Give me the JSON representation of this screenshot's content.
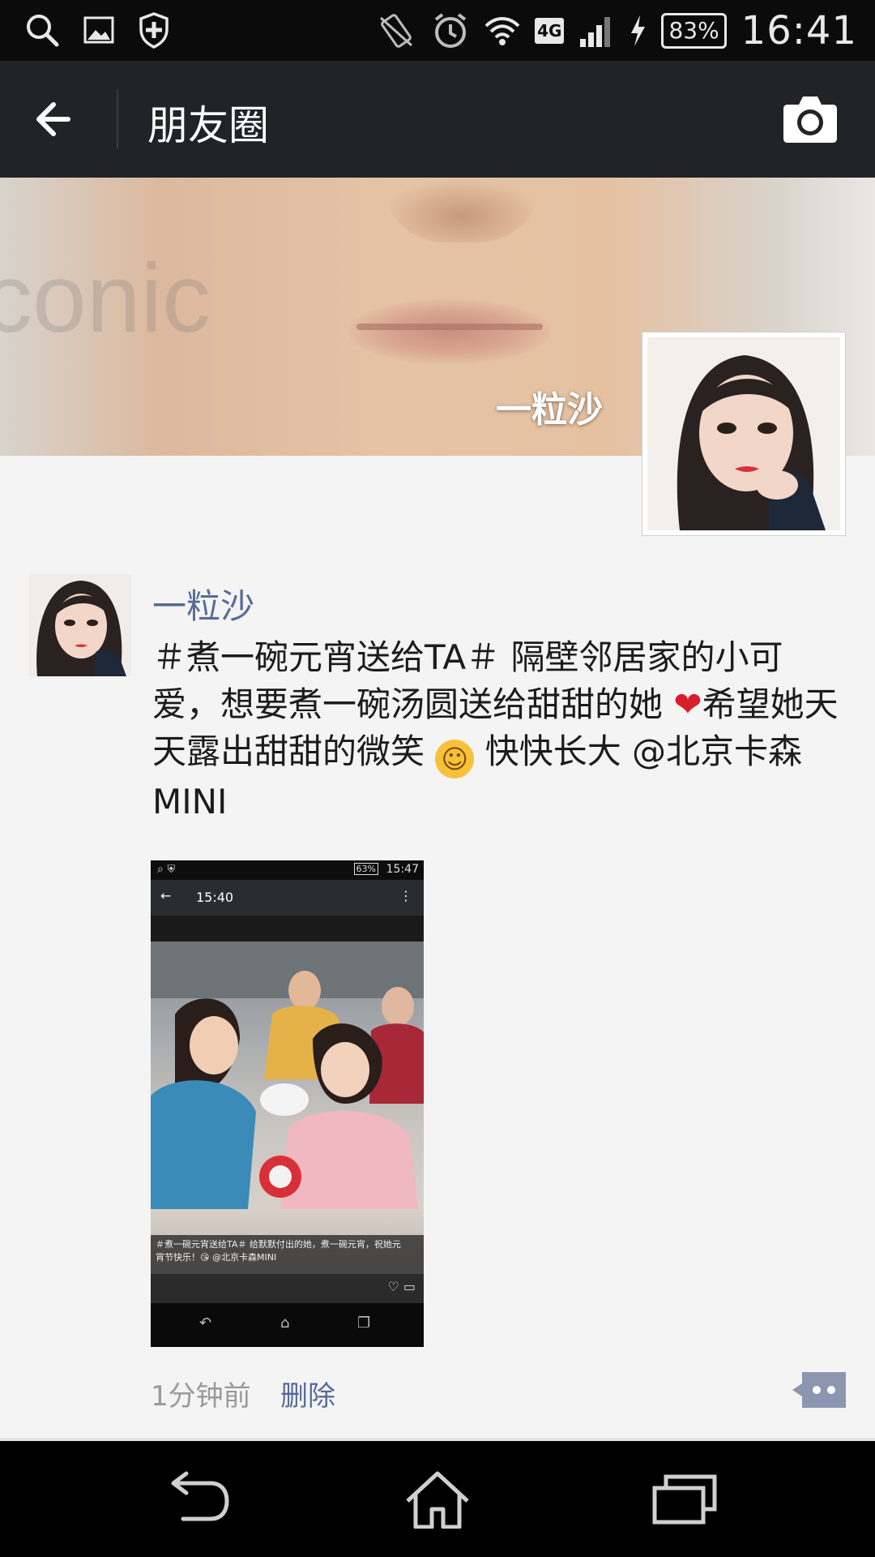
{
  "status_bar": {
    "time": "16:41",
    "battery": "83%",
    "network": "4G",
    "icons": [
      "search-icon",
      "gallery-icon",
      "shield-icon",
      "vibrate-icon",
      "alarm-icon",
      "wifi-icon",
      "signal-icon",
      "charging-icon"
    ]
  },
  "app_bar": {
    "title": "朋友圈",
    "back_icon": "back-arrow-icon",
    "camera_icon": "camera-icon"
  },
  "cover": {
    "watermark": "conic",
    "user_name": "一粒沙"
  },
  "post": {
    "author": "一粒沙",
    "text_part1": "＃煮一碗元宵送给TA＃ 隔壁邻居家的小可爱，想要煮一碗汤圆送给甜甜的她 ",
    "heart": "❤",
    "text_part2": "希望她天天露出甜甜的微笑 ",
    "smile": "☺",
    "text_part3": " 快快长大 @北京卡森MINI",
    "time_ago": "1分钟前",
    "delete_label": "删除",
    "embedded_screenshot": {
      "status_time": "15:47",
      "status_battery": "63%",
      "bar_time": "15:40",
      "caption": "＃煮一碗元宵送给TA＃ 给默默付出的她，煮一碗元宵，祝她元宵节快乐！😘 @北京卡森MINI"
    }
  },
  "nav_bar": {
    "icons": [
      "back-icon",
      "home-icon",
      "recent-apps-icon"
    ]
  },
  "colors": {
    "status_bar": "#0b0b0b",
    "app_bar": "#212326",
    "link": "#576b95",
    "background": "#f4f4f4"
  }
}
